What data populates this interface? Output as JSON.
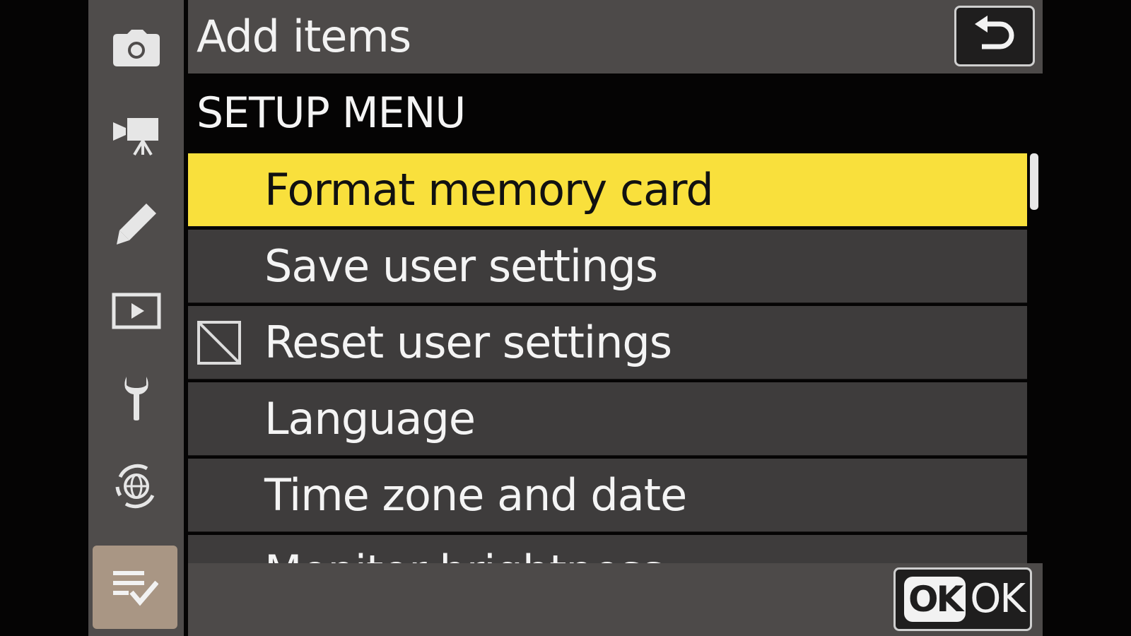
{
  "header": {
    "title": "Add items",
    "back_icon": "return-arrow-icon"
  },
  "section": {
    "title": "SETUP MENU"
  },
  "menu": {
    "items": [
      {
        "label": "Format memory card",
        "selected": true,
        "checkbox": false
      },
      {
        "label": "Save user settings",
        "selected": false,
        "checkbox": false
      },
      {
        "label": "Reset user settings",
        "selected": false,
        "checkbox": true
      },
      {
        "label": "Language",
        "selected": false,
        "checkbox": false
      },
      {
        "label": "Time zone and date",
        "selected": false,
        "checkbox": false
      },
      {
        "label": "Monitor brightness",
        "selected": false,
        "checkbox": false
      }
    ]
  },
  "sidebar": {
    "items": [
      {
        "icon": "camera-icon",
        "active": false
      },
      {
        "icon": "movie-camera-icon",
        "active": false
      },
      {
        "icon": "pencil-icon",
        "active": false
      },
      {
        "icon": "playback-icon",
        "active": false
      },
      {
        "icon": "wrench-icon",
        "active": false
      },
      {
        "icon": "network-globe-icon",
        "active": false
      },
      {
        "icon": "my-menu-icon",
        "active": true
      }
    ]
  },
  "footer": {
    "ok_badge": "OK",
    "ok_label": "OK"
  },
  "colors": {
    "highlight": "#f9e03c",
    "sidebar_active": "#a99684",
    "panel": "#4d4a49",
    "row": "#3e3c3c"
  }
}
